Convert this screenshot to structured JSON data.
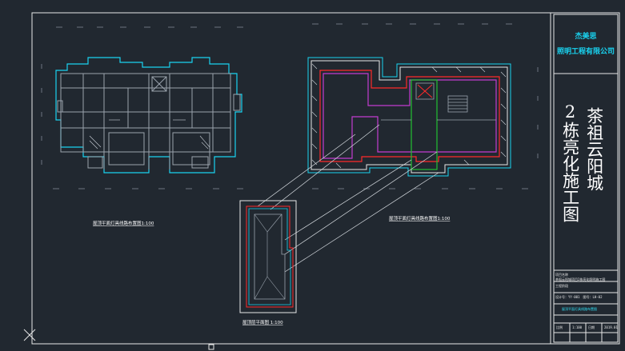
{
  "colors": {
    "background": "#212830",
    "frame": "#e8e8e8",
    "wall_gray": "#9aa3ad",
    "cyan": "#19d3f0",
    "red": "#ff2a2a",
    "magenta": "#c23ccf",
    "green": "#22c032",
    "white": "#ffffff"
  },
  "title_block": {
    "designer": "杰美思",
    "company": "照明工程有限公司",
    "project_title_col1": "2栋亮化施工图",
    "project_title_col2": "茶祖云阳城",
    "info_lines": [
      "项目名称",
      "茶祖云阳城项目2栋亮化照明施工图",
      "工程阶段",
      "设计号：YY-001　图号：LH-02",
      "屋顶平面灯具线路布置图"
    ],
    "footer_row": [
      "比例",
      "1:100",
      "日期",
      "2019.01"
    ]
  },
  "drawings": {
    "left_plan_label": "屋顶平面灯具线路布置图1:100",
    "right_plan_label": "屋顶平面灯具线路布置图1:100",
    "roof_plan_label": "屋顶层平面图 1:100"
  }
}
